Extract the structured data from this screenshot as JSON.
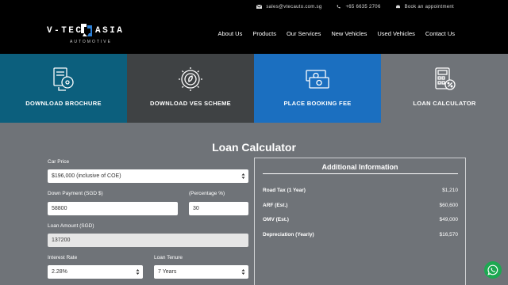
{
  "topbar": {
    "email": "sales@vtecauto.com.sg",
    "phone": "+65 6635 2706",
    "appointment": "Book an appointment"
  },
  "logo": {
    "word_left": "V-TEC",
    "word_right": "ASIA",
    "sub": "AUTOMOTIVE"
  },
  "nav": [
    "About Us",
    "Products",
    "Our Services",
    "New Vehicles",
    "Used Vehicles",
    "Contact Us"
  ],
  "tiles": [
    {
      "label": "DOWNLOAD BROCHURE",
      "icon": "brochure-icon",
      "color": "#0c5f7d"
    },
    {
      "label": "DOWNLOAD VES SCHEME",
      "icon": "gear-leaf-icon",
      "color": "#3f4244"
    },
    {
      "label": "PLACE BOOKING FEE",
      "icon": "money-icon",
      "color": "#1b6fc0"
    },
    {
      "label": "LOAN CALCULATOR",
      "icon": "calculator-icon",
      "color": "#6f7378"
    }
  ],
  "calculator": {
    "title": "Loan Calculator",
    "car_price_label": "Car Price",
    "car_price_value": "$196,000 (inclusive of COE)",
    "down_payment_label": "Down Payment (SGD $)",
    "down_payment_value": "58800",
    "percentage_label": "(Percentage %)",
    "percentage_value": "30",
    "loan_amount_label": "Loan Amount (SGD)",
    "loan_amount_value": "137200",
    "interest_label": "Interest Rate",
    "interest_value": "2.28%",
    "tenure_label": "Loan Tenure",
    "tenure_value": "7 Years"
  },
  "info": {
    "title": "Additional Information",
    "rows": [
      {
        "key": "Road Tax (1 Year)",
        "value": "$1,210"
      },
      {
        "key": "ARF (Est.)",
        "value": "$60,600"
      },
      {
        "key": "OMV (Est.)",
        "value": "$49,000"
      },
      {
        "key": "Depreciation (Yearly)",
        "value": "$16,570"
      }
    ]
  },
  "whatsapp_icon": "whatsapp-icon"
}
